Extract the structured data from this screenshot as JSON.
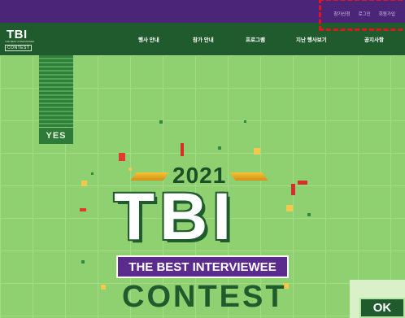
{
  "utility": {
    "links": [
      "참가신청",
      "로그인",
      "회원가입"
    ]
  },
  "logo": {
    "text": "TBI",
    "tagline": "THE BEST INTERVIEWEE",
    "subtext": "CONTEST"
  },
  "nav": {
    "items": [
      "행사 안내",
      "참가 안내",
      "프로그램",
      "지난 행사보기",
      "공지사항"
    ]
  },
  "hero": {
    "year": "2021",
    "title": "TBI",
    "banner": "THE BEST INTERVIEWEE",
    "contest": "CONTEST"
  },
  "buttons": {
    "yes": "YES",
    "ok": "OK"
  },
  "colors": {
    "purple": "#4b2577",
    "nav_green": "#1f5b2c",
    "bg_green": "#8fd070",
    "red_dashed": "#e3141b"
  }
}
